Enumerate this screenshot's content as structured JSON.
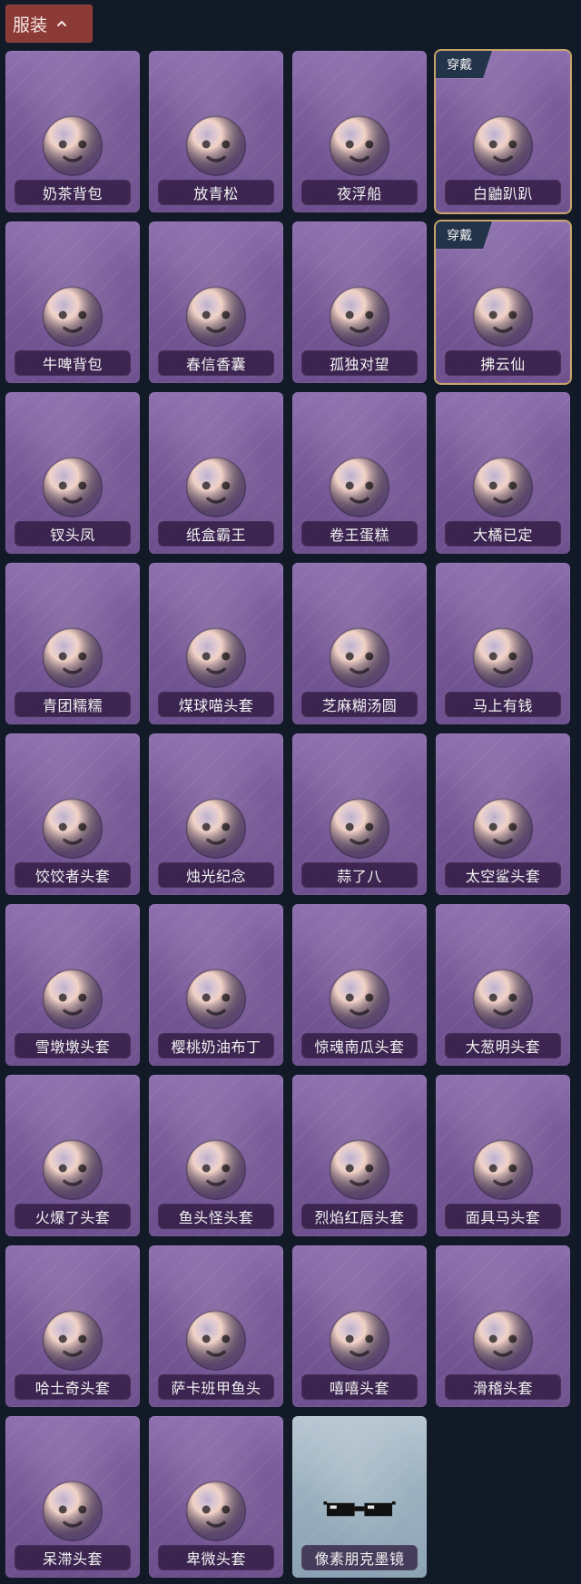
{
  "header": {
    "tab_label": "服装"
  },
  "items": [
    {
      "label": "奶茶背包",
      "icon": "milk-tea-backpack-icon",
      "color": "#f2d2c7"
    },
    {
      "label": "放青松",
      "icon": "pine-bonsai-icon",
      "color": "#3c9b5b"
    },
    {
      "label": "夜浮船",
      "icon": "jellyfish-lantern-icon",
      "color": "#7fc3f2"
    },
    {
      "label": "白鼬趴趴",
      "icon": "white-ferret-charm-icon",
      "color": "#eef2ff",
      "badge": "穿戴"
    },
    {
      "label": "牛啤背包",
      "icon": "cow-beer-backpack-icon",
      "color": "#f2c2a8"
    },
    {
      "label": "春信香囊",
      "icon": "scented-sachet-icon",
      "color": "#b9f0b5"
    },
    {
      "label": "孤独对望",
      "icon": "fairy-charm-icon",
      "color": "#d7e6ff"
    },
    {
      "label": "拂云仙",
      "icon": "cloud-fairy-charm-icon",
      "color": "#f2e8dd",
      "badge": "穿戴"
    },
    {
      "label": "钗头凤",
      "icon": "phoenix-headdress-icon",
      "color": "#d8a33a"
    },
    {
      "label": "纸盒霸王",
      "icon": "box-dinosaur-head-icon",
      "color": "#4db7b0"
    },
    {
      "label": "卷王蛋糕",
      "icon": "roll-cake-icon",
      "color": "#f3c2a4"
    },
    {
      "label": "大橘已定",
      "icon": "orange-slice-icon",
      "color": "#ff9a2e"
    },
    {
      "label": "青团糯糯",
      "icon": "green-dumpling-icon",
      "color": "#6ed06a"
    },
    {
      "label": "煤球喵头套",
      "icon": "black-cat-head-icon",
      "color": "#3d4657"
    },
    {
      "label": "芝麻糊汤圆",
      "icon": "tangyuan-head-icon",
      "color": "#f3f6ff"
    },
    {
      "label": "马上有钱",
      "icon": "red-horse-head-icon",
      "color": "#e64552"
    },
    {
      "label": "饺饺者头套",
      "icon": "dumpling-cloud-head-icon",
      "color": "#f2f4f7"
    },
    {
      "label": "烛光纪念",
      "icon": "candle-head-icon",
      "color": "#ffe0c8"
    },
    {
      "label": "蒜了八",
      "icon": "garlic-head-icon",
      "color": "#f6f0e2"
    },
    {
      "label": "太空鲨头套",
      "icon": "space-shark-head-icon",
      "color": "#7fd1ff"
    },
    {
      "label": "雪墩墩头套",
      "icon": "snowman-reindeer-head-icon",
      "color": "#5aa0ff"
    },
    {
      "label": "樱桃奶油布丁",
      "icon": "cherry-pudding-head-icon",
      "color": "#f4b36b"
    },
    {
      "label": "惊魂南瓜头套",
      "icon": "pumpkin-head-icon",
      "color": "#ff8a1e"
    },
    {
      "label": "大葱明头套",
      "icon": "green-onion-head-icon",
      "color": "#67c76f"
    },
    {
      "label": "火爆了头套",
      "icon": "fire-head-icon",
      "color": "#ff5a1f"
    },
    {
      "label": "鱼头怪头套",
      "icon": "fish-mask-head-icon",
      "color": "#4f9b58"
    },
    {
      "label": "烈焰红唇头套",
      "icon": "pikachu-lips-head-icon",
      "color": "#ffd03a"
    },
    {
      "label": "面具马头套",
      "icon": "horse-mask-head-icon",
      "color": "#7a4a2f"
    },
    {
      "label": "哈士奇头套",
      "icon": "husky-sunglasses-head-icon",
      "color": "#6b4b2d"
    },
    {
      "label": "萨卡班甲鱼头",
      "icon": "fish-head-icon",
      "color": "#2e3c47"
    },
    {
      "label": "嘻嘻头套",
      "icon": "grin-emoji-head-icon",
      "color": "#ffd12a"
    },
    {
      "label": "滑稽头套",
      "icon": "smirk-emoji-head-icon",
      "color": "#ffd12a"
    },
    {
      "label": "呆滞头套",
      "icon": "stare-emoji-head-icon",
      "color": "#ffd12a"
    },
    {
      "label": "卑微头套",
      "icon": "humble-emoji-head-icon",
      "color": "#ffd12a"
    },
    {
      "label": "像素朋克墨镜",
      "icon": "pixel-sunglasses-icon",
      "color": "#111111",
      "special": true
    }
  ]
}
